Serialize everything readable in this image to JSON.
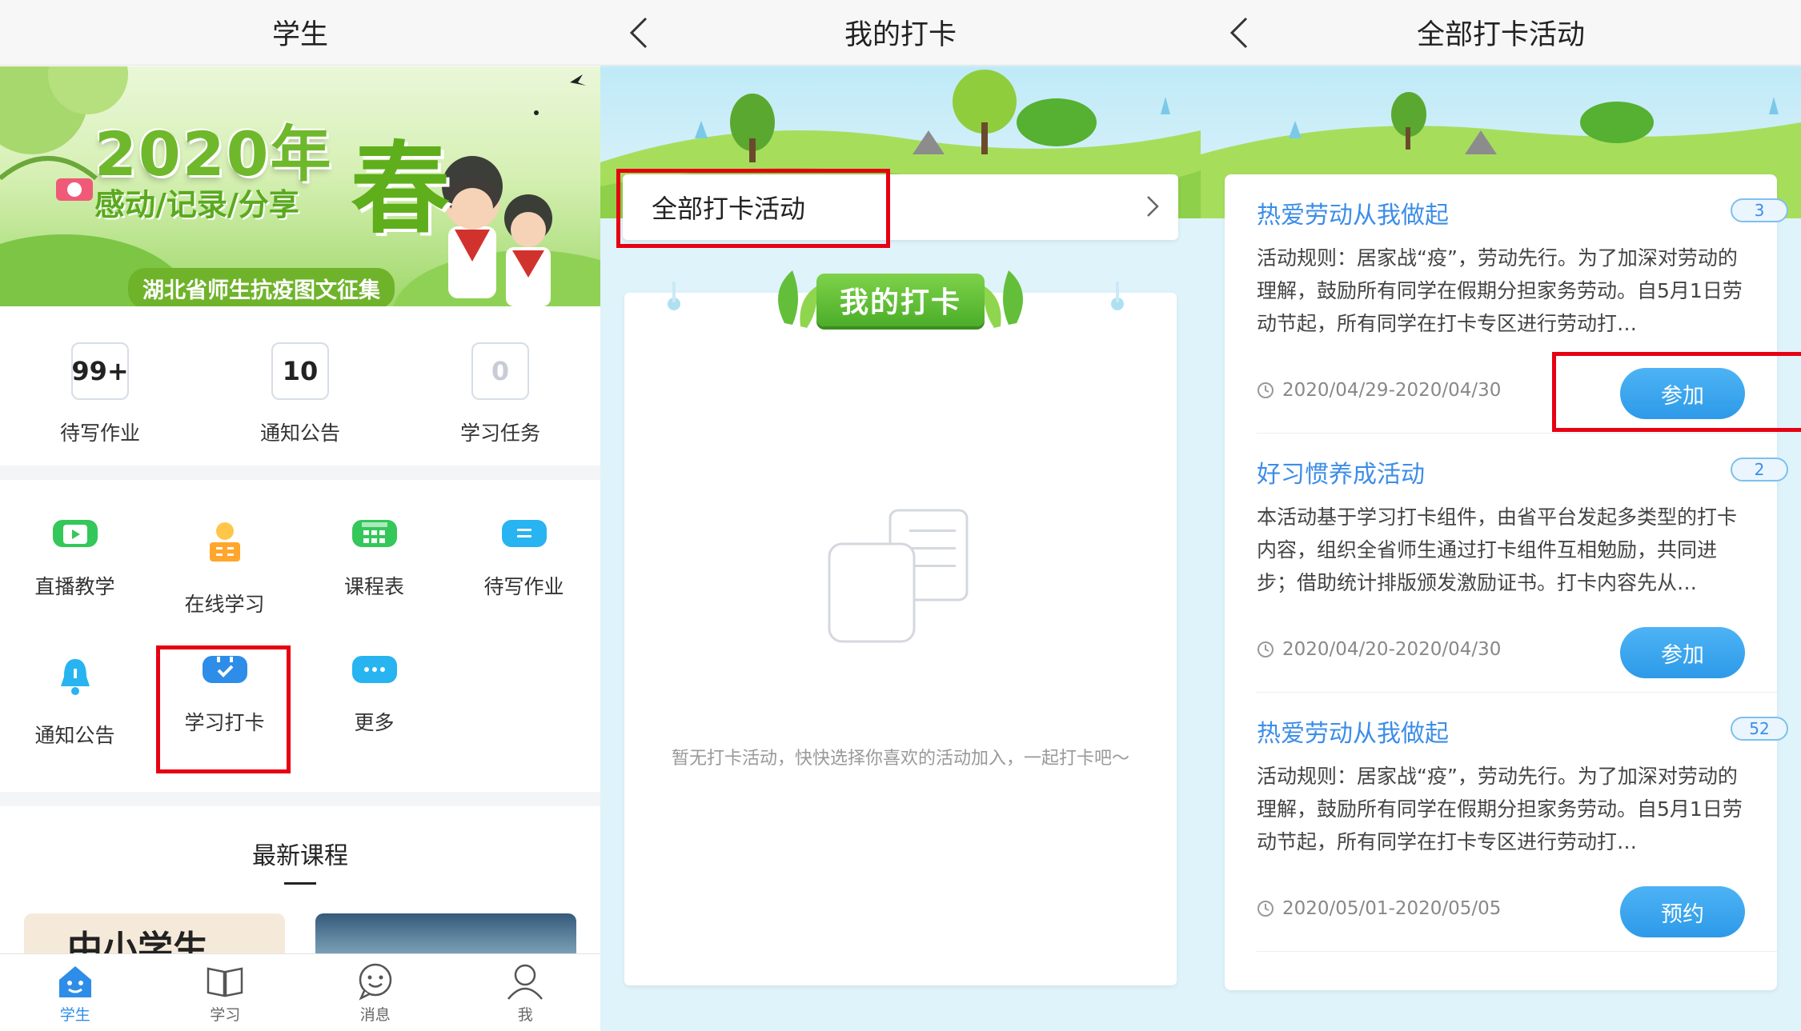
{
  "panel1": {
    "title": "学生",
    "banner": {
      "headline": "2020年",
      "spring": "春",
      "subtitle": "感动/记录/分享",
      "tagline": "湖北省师生抗疫图文征集"
    },
    "stats": [
      {
        "value": "99+",
        "label": "待写作业"
      },
      {
        "value": "10",
        "label": "通知公告"
      },
      {
        "value": "0",
        "label": "学习任务"
      }
    ],
    "grid": [
      {
        "label": "直播教学",
        "icon": "tv-play-icon",
        "color": "#34c759"
      },
      {
        "label": "在线学习",
        "icon": "reading-person-icon",
        "color": "#ffa62b"
      },
      {
        "label": "课程表",
        "icon": "calendar-grid-icon",
        "color": "#34c759"
      },
      {
        "label": "待写作业",
        "icon": "homework-icon",
        "color": "#27b4f0"
      },
      {
        "label": "通知公告",
        "icon": "bell-icon",
        "color": "#27b4f0"
      },
      {
        "label": "学习打卡",
        "icon": "checkin-calendar-icon",
        "color": "#2d8de8"
      },
      {
        "label": "更多",
        "icon": "more-dots-icon",
        "color": "#27b4f0"
      }
    ],
    "latest_title": "最新课程",
    "thumb1_text": "中小学生",
    "tabs": [
      {
        "label": "学生",
        "icon": "home-icon"
      },
      {
        "label": "学习",
        "icon": "book-icon"
      },
      {
        "label": "消息",
        "icon": "message-icon"
      },
      {
        "label": "我",
        "icon": "profile-icon"
      }
    ]
  },
  "panel2": {
    "title": "我的打卡",
    "all_activities": "全部打卡活动",
    "ribbon": "我的打卡",
    "empty_text": "暂无打卡活动，快快选择你喜欢的活动加入，一起打卡吧～"
  },
  "panel3": {
    "title": "全部打卡活动",
    "cards": [
      {
        "title": "热爱劳动从我做起",
        "badge": "3",
        "desc": "活动规则：居家战“疫”，劳动先行。为了加深对劳动的理解，鼓励所有同学在假期分担家务劳动。自5月1日劳动节起，所有同学在打卡专区进行劳动打…",
        "date": "2020/04/29-2020/04/30",
        "button": "参加"
      },
      {
        "title": "好习惯养成活动",
        "badge": "2",
        "desc": "本活动基于学习打卡组件，由省平台发起多类型的打卡内容，组织全省师生通过打卡组件互相勉励，共同进步；借助统计排版颁发激励证书。打卡内容先从…",
        "date": "2020/04/20-2020/04/30",
        "button": "参加"
      },
      {
        "title": "热爱劳动从我做起",
        "badge": "52",
        "desc": "活动规则：居家战“疫”，劳动先行。为了加深对劳动的理解，鼓励所有同学在假期分担家务劳动。自5月1日劳动节起，所有同学在打卡专区进行劳动打…",
        "date": "2020/05/01-2020/05/05",
        "button": "预约"
      }
    ]
  },
  "colors": {
    "accent": "#2d8de8",
    "highlight": "#e60012",
    "green": "#5fae1c"
  }
}
